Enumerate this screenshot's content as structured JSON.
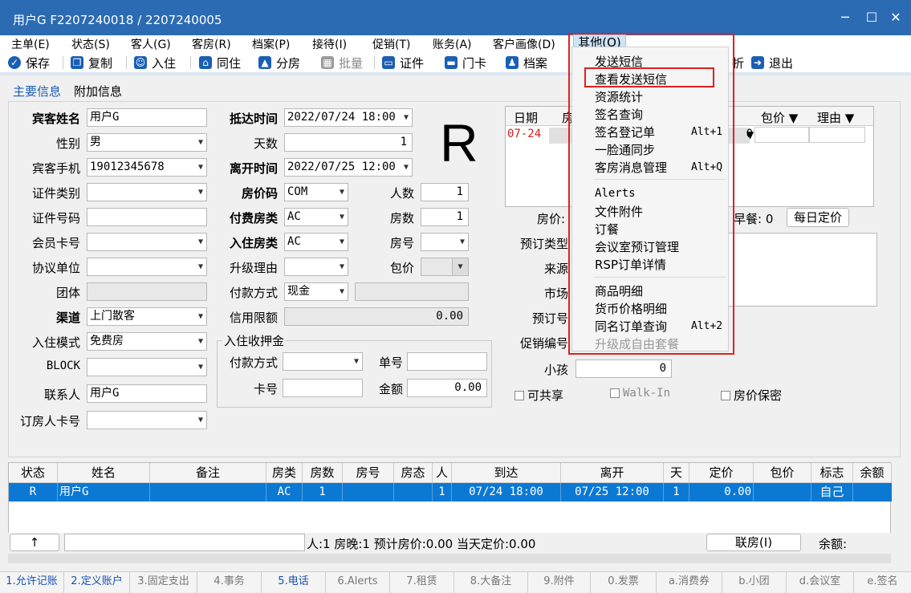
{
  "window": {
    "title": "用户G  F2207240018 / 2207240005",
    "min": "─",
    "max": "☐",
    "close": "✕"
  },
  "menubar": [
    "主单(E)",
    "状态(S)",
    "客人(G)",
    "客房(R)",
    "档案(P)",
    "接待(I)",
    "促销(T)",
    "账务(A)",
    "客户画像(D)",
    "其他(O)"
  ],
  "toolbar": [
    {
      "label": "保存"
    },
    {
      "label": "复制"
    },
    {
      "label": "入住"
    },
    {
      "label": "同住"
    },
    {
      "label": "分房"
    },
    {
      "label": "批量"
    },
    {
      "label": "证件"
    },
    {
      "label": "门卡"
    },
    {
      "label": "档案"
    },
    {
      "label": "折"
    },
    {
      "label": "退出"
    }
  ],
  "tabs": [
    "主要信息",
    "附加信息"
  ],
  "form": {
    "guest_name_label": "宾客姓名",
    "guest_name": "用户G",
    "gender_label": "性别",
    "gender": "男",
    "phone_label": "宾客手机",
    "phone": "19012345678",
    "id_type_label": "证件类别",
    "id_type": "",
    "id_no_label": "证件号码",
    "id_no": "",
    "member_label": "会员卡号",
    "member": "",
    "agreement_label": "协议单位",
    "agreement": "",
    "group_label": "团体",
    "group": "",
    "channel_label": "渠道",
    "channel": "上门散客",
    "checkin_mode_label": "入住模式",
    "checkin_mode": "免费房",
    "block_label": "BLOCK",
    "block": "",
    "contact_label": "联系人",
    "contact": "用户G",
    "booker_label": "订房人卡号",
    "booker": "",
    "arrive_label": "抵达时间",
    "arrive": "2022/07/24 18:00",
    "days_label": "天数",
    "days": "1",
    "depart_label": "离开时间",
    "depart": "2022/07/25 12:00",
    "rate_code_label": "房价码",
    "rate_code": "COM",
    "pay_type_label": "付费房类",
    "pay_type": "AC",
    "room_type_label": "入住房类",
    "room_type": "AC",
    "upgrade_label": "升级理由",
    "upgrade": "",
    "pay_method_label": "付款方式",
    "pay_method": "现金",
    "credit_label": "信用限额",
    "credit": "0.00",
    "persons_label": "人数",
    "persons": "1",
    "rooms_label": "房数",
    "rooms": "1",
    "room_no_label": "房号",
    "room_no": "",
    "package_label": "包价",
    "package": "",
    "status_letter": "R",
    "deposit_group": "入住收押金",
    "dep_pay_label": "付款方式",
    "dep_pay": "",
    "dep_card_label": "卡号",
    "dep_card": "",
    "dep_no_label": "单号",
    "dep_no": "",
    "dep_amt_label": "金额",
    "dep_amt": "0.00"
  },
  "rate_grid": {
    "cols": [
      "日期",
      "房",
      "包价 ▼",
      "理由 ▼"
    ],
    "row_date": "07-24",
    "row_val": "0",
    "row_mid": "▼"
  },
  "right": {
    "price_label": "房价:",
    "breakfast": "早餐: 0",
    "daily_btn": "每日定价",
    "book_type_label": "预订类型",
    "source_label": "来源",
    "market_label": "市场",
    "book_no_label": "预订号",
    "promo_label": "促销编号",
    "child_label": "小孩",
    "child": "0",
    "share": "可共享",
    "walkin": "Walk-In",
    "secret": "房价保密"
  },
  "menu": {
    "head": "其他(O)",
    "items": [
      {
        "label": "发送短信",
        "sc": ""
      },
      {
        "label": "查看发送短信",
        "sc": ""
      },
      {
        "label": "资源统计",
        "sc": ""
      },
      {
        "label": "签名查询",
        "sc": ""
      },
      {
        "label": "签名登记单",
        "sc": "Alt+1"
      },
      {
        "label": "一脸通同步",
        "sc": ""
      },
      {
        "label": "客房消息管理",
        "sc": "Alt+Q"
      },
      {
        "label": "Alerts",
        "sc": ""
      },
      {
        "label": "文件附件",
        "sc": ""
      },
      {
        "label": "订餐",
        "sc": ""
      },
      {
        "label": "会议室预订管理",
        "sc": ""
      },
      {
        "label": "RSP订单详情",
        "sc": ""
      },
      {
        "label": "商品明细",
        "sc": ""
      },
      {
        "label": "货币价格明细",
        "sc": ""
      },
      {
        "label": "同名订单查询",
        "sc": "Alt+2"
      },
      {
        "label": "升级成自由套餐",
        "sc": ""
      }
    ]
  },
  "table": {
    "headers": [
      "状态",
      "姓名",
      "备注",
      "房类",
      "房数",
      "房号",
      "房态",
      "人",
      "到达",
      "离开",
      "天",
      "定价",
      "包价",
      "标志",
      "余额"
    ],
    "row": [
      "R",
      "用户G",
      "",
      "AC",
      "1",
      "",
      "",
      "1",
      "07/24 18:00",
      "07/25 12:00",
      "1",
      "0.00",
      "",
      "自己",
      ""
    ]
  },
  "status": {
    "arrow": "↑",
    "summary": "人:1  房晚:1  预计房价:0.00  当天定价:0.00",
    "join_btn": "联房(I)",
    "balance": "余额:"
  },
  "fkeys": [
    "1.允许记账",
    "2.定义账户",
    "3.固定支出",
    "4.事务",
    "5.电话",
    "6.Alerts",
    "7.租赁",
    "8.大备注",
    "9.附件",
    "0.发票",
    "a.消费券",
    "b.小团",
    "d.会议室",
    "e.签名"
  ]
}
